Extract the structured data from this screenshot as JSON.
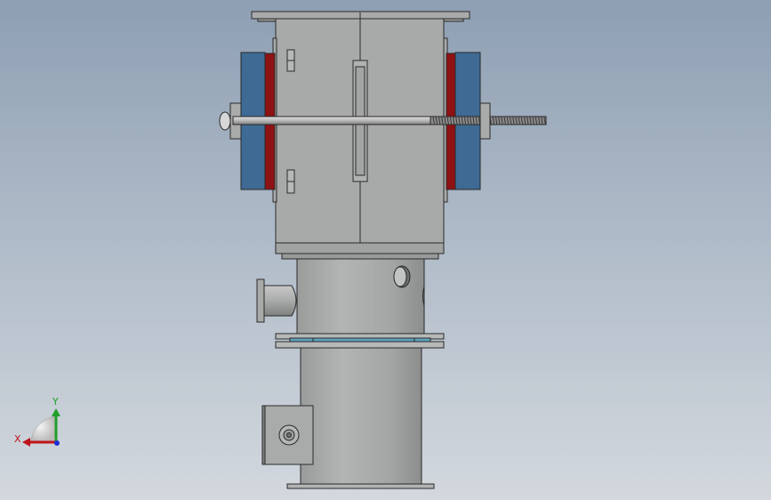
{
  "triad": {
    "x_label": "X",
    "y_label": "Y",
    "x_color": "#c0141c",
    "y_color": "#1f9e2a",
    "z_color": "#1c2fd6"
  },
  "colors": {
    "body_fill": "#a7a9a8",
    "body_dark": "#8f9190",
    "outline": "#2a2a2a",
    "flange_blue": "#3e6a94",
    "gasket_red": "#8e1113",
    "glass_cyan": "#5fa3bd"
  }
}
